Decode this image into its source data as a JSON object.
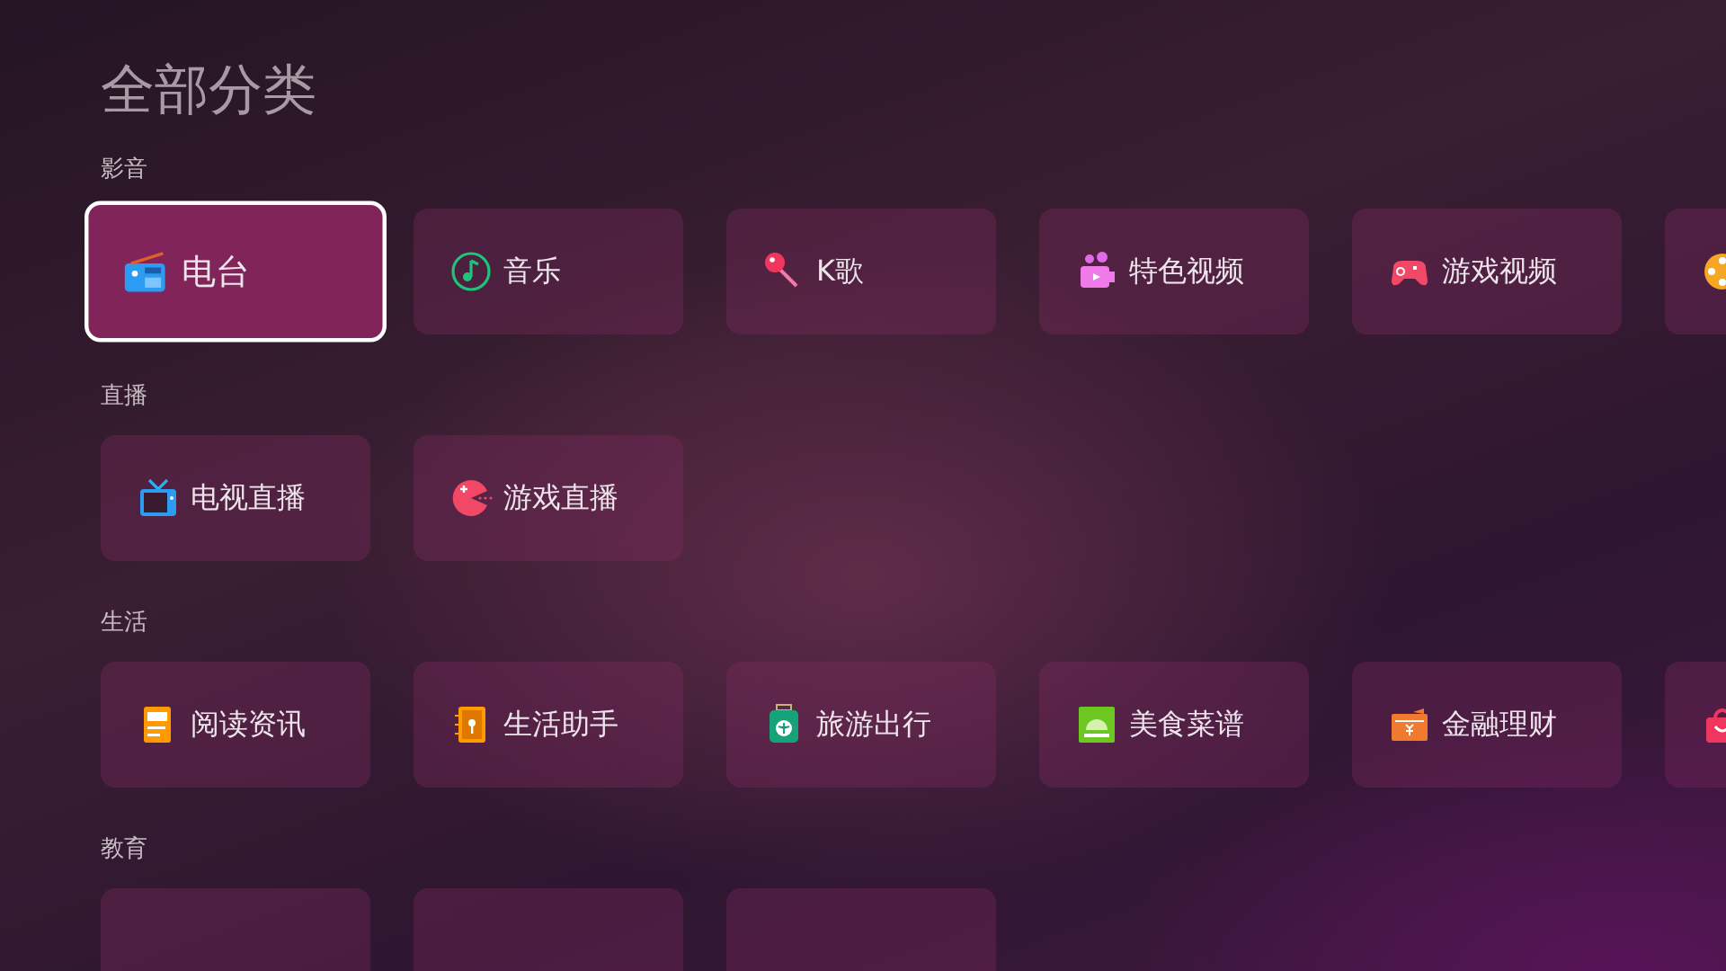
{
  "title": "全部分类",
  "sections": [
    {
      "label": "影音",
      "items": [
        {
          "kind": "radio",
          "label": "电台",
          "selected": true
        },
        {
          "kind": "music",
          "label": "音乐",
          "selected": false
        },
        {
          "kind": "mic",
          "label": "K歌",
          "selected": false
        },
        {
          "kind": "camera",
          "label": "特色视频",
          "selected": false
        },
        {
          "kind": "gamepad",
          "label": "游戏视频",
          "selected": false
        },
        {
          "kind": "film",
          "selected": false
        }
      ]
    },
    {
      "label": "直播",
      "items": [
        {
          "kind": "tv",
          "label": "电视直播",
          "selected": false
        },
        {
          "kind": "pacman",
          "label": "游戏直播",
          "selected": false
        }
      ]
    },
    {
      "label": "生活",
      "items": [
        {
          "kind": "news",
          "label": "阅读资讯",
          "selected": false
        },
        {
          "kind": "notebook",
          "label": "生活助手",
          "selected": false
        },
        {
          "kind": "luggage",
          "label": "旅游出行",
          "selected": false
        },
        {
          "kind": "dish",
          "label": "美食菜谱",
          "selected": false
        },
        {
          "kind": "wallet",
          "label": "金融理财",
          "selected": false
        },
        {
          "kind": "bag",
          "selected": false
        }
      ]
    },
    {
      "label": "教育",
      "items": [
        {
          "kind": "empty",
          "selected": false
        },
        {
          "kind": "empty",
          "selected": false
        },
        {
          "kind": "empty",
          "selected": false
        }
      ]
    }
  ]
}
